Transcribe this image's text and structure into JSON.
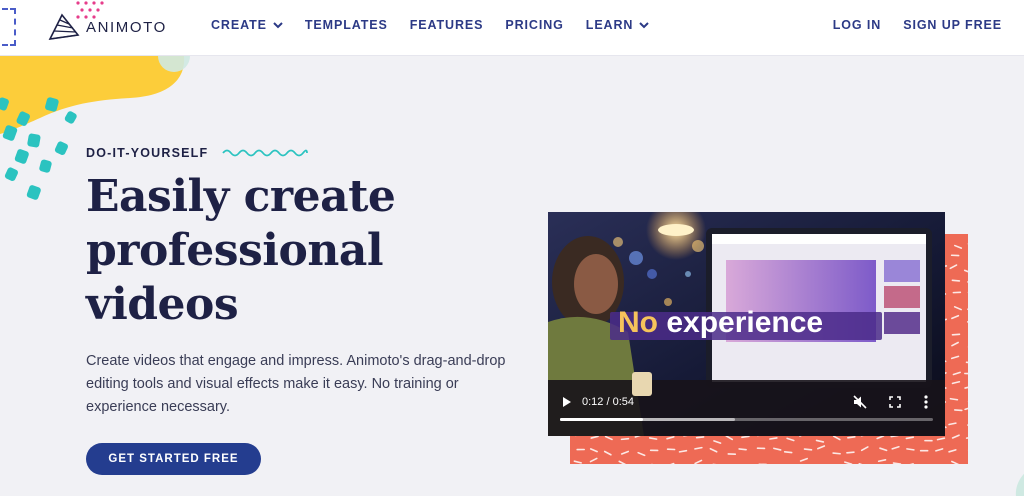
{
  "nav": {
    "logo_text": "ANIMOTO",
    "links": [
      {
        "label": "CREATE",
        "has_dropdown": true
      },
      {
        "label": "TEMPLATES",
        "has_dropdown": false
      },
      {
        "label": "FEATURES",
        "has_dropdown": false
      },
      {
        "label": "PRICING",
        "has_dropdown": false
      },
      {
        "label": "LEARN",
        "has_dropdown": true
      }
    ],
    "login": "LOG IN",
    "signup": "SIGN UP FREE"
  },
  "hero": {
    "eyebrow": "DO-IT-YOURSELF",
    "headline": "Easily create professional videos",
    "subcopy": "Create videos that engage and impress. Animoto's drag-and-drop editing tools and visual effects make it easy. No training or experience necessary.",
    "cta": "GET STARTED FREE"
  },
  "video": {
    "caption_highlight": "No",
    "caption_rest": "experience",
    "time": "0:12 / 0:54",
    "progress": 0.222,
    "buffered": 0.47,
    "play_icon": "play-icon",
    "mute_icon": "mute-icon",
    "fullscreen_icon": "fullscreen-icon",
    "more_icon": "more-vertical-icon"
  },
  "colors": {
    "brand_navy": "#1e2145",
    "cta_blue": "#243d8f",
    "nav_link": "#2c3a86",
    "coral": "#ee6a55",
    "yellow": "#fccd3a",
    "teal": "#2bc3c0",
    "pink": "#e63d8b"
  }
}
